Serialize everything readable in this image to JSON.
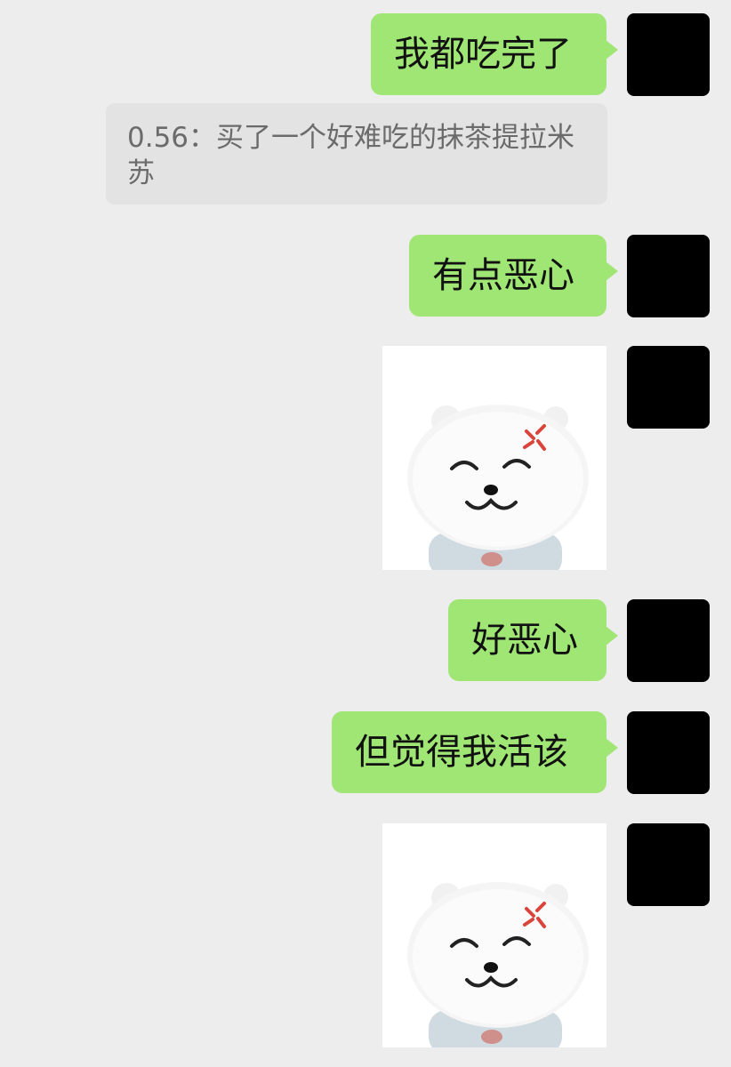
{
  "messages": {
    "m1_text": "我都吃完了",
    "quote_text": "0.56：买了一个好难吃的抹茶提拉米苏",
    "m2_text": "有点恶心",
    "m4_text": "好恶心",
    "m5_text": "但觉得我活该"
  },
  "stickers": {
    "icon": "angry-bear-sticker-icon"
  },
  "colors": {
    "background": "#ededed",
    "bubble_outgoing": "#a0e675",
    "quote_bg": "#e3e3e3",
    "quote_text": "#6b6b6b",
    "avatar": "#000000",
    "anger_mark": "#d9453b"
  }
}
